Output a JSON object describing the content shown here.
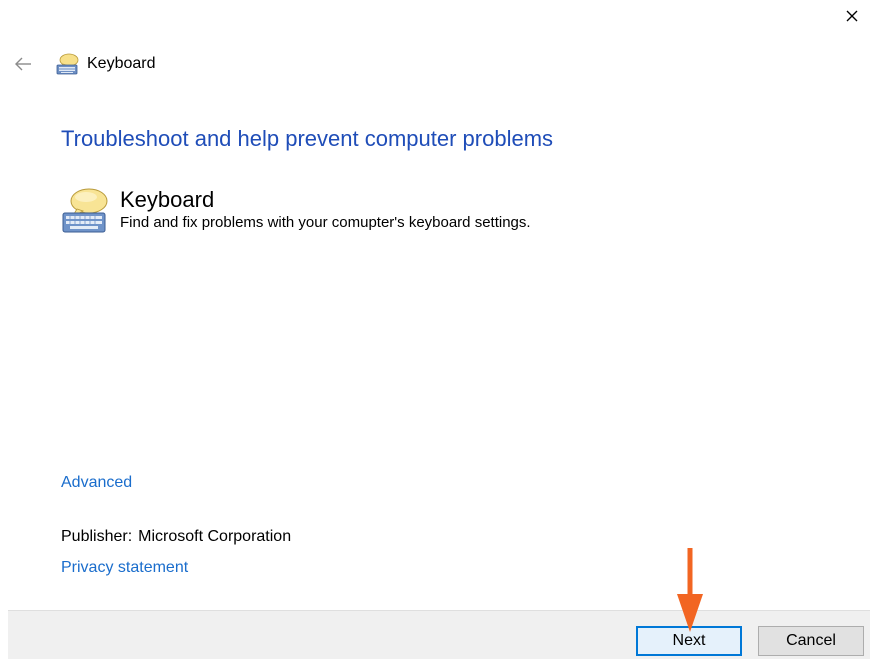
{
  "window": {
    "title": "Keyboard",
    "close_icon": "close-icon",
    "back_icon": "back-arrow-icon",
    "title_icon": "keyboard-troubleshooter-icon"
  },
  "main": {
    "heading": "Troubleshoot and help prevent computer problems",
    "tool": {
      "icon": "keyboard-speech-bubble-icon",
      "name": "Keyboard",
      "description": "Find and fix problems with your comupter's keyboard settings."
    },
    "advanced_link": "Advanced",
    "publisher_label": "Publisher:",
    "publisher_value": "Microsoft Corporation",
    "privacy_link": "Privacy statement"
  },
  "footer": {
    "next_label": "Next",
    "cancel_label": "Cancel"
  },
  "colors": {
    "heading": "#1f4db8",
    "link": "#1a6dcc",
    "annotation_arrow": "#f26522",
    "focus_border": "#0078d7",
    "footer_bg": "#f0f0f0"
  }
}
